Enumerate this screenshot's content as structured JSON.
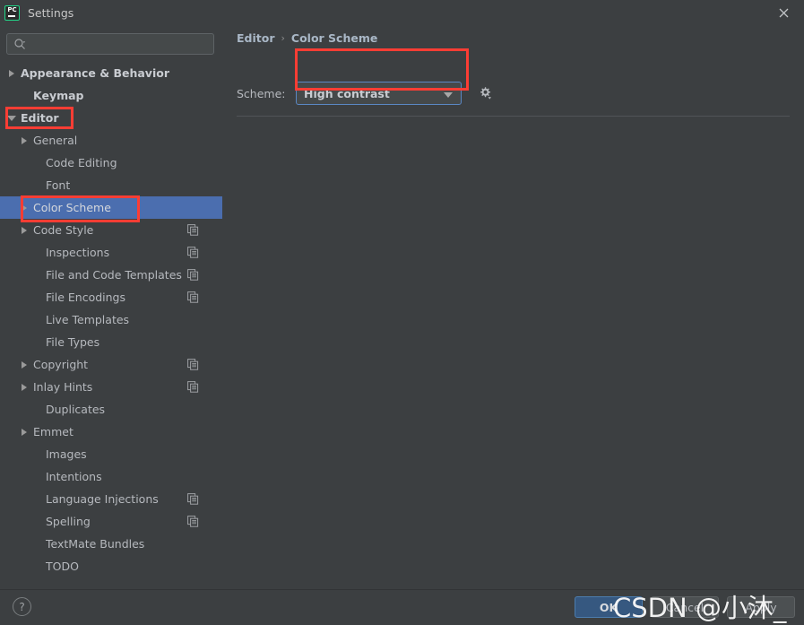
{
  "window": {
    "title": "Settings",
    "logo_icon": "pycharm-logo-icon",
    "close_icon": "close-icon"
  },
  "search": {
    "placeholder": "",
    "value": "",
    "icon": "search-icon"
  },
  "sidebar": {
    "items": [
      {
        "label": "Appearance & Behavior",
        "indent": 0,
        "twisty": "collapsed",
        "bold": true,
        "selected": false,
        "copy": false
      },
      {
        "label": "Keymap",
        "indent": 1,
        "twisty": "none",
        "bold": true,
        "selected": false,
        "copy": false
      },
      {
        "label": "Editor",
        "indent": 0,
        "twisty": "expanded",
        "bold": true,
        "selected": false,
        "copy": false
      },
      {
        "label": "General",
        "indent": 1,
        "twisty": "collapsed",
        "bold": false,
        "selected": false,
        "copy": false
      },
      {
        "label": "Code Editing",
        "indent": 2,
        "twisty": "none",
        "bold": false,
        "selected": false,
        "copy": false
      },
      {
        "label": "Font",
        "indent": 2,
        "twisty": "none",
        "bold": false,
        "selected": false,
        "copy": false
      },
      {
        "label": "Color Scheme",
        "indent": 1,
        "twisty": "collapsed",
        "bold": false,
        "selected": true,
        "copy": false
      },
      {
        "label": "Code Style",
        "indent": 1,
        "twisty": "collapsed",
        "bold": false,
        "selected": false,
        "copy": true
      },
      {
        "label": "Inspections",
        "indent": 2,
        "twisty": "none",
        "bold": false,
        "selected": false,
        "copy": true
      },
      {
        "label": "File and Code Templates",
        "indent": 2,
        "twisty": "none",
        "bold": false,
        "selected": false,
        "copy": true
      },
      {
        "label": "File Encodings",
        "indent": 2,
        "twisty": "none",
        "bold": false,
        "selected": false,
        "copy": true
      },
      {
        "label": "Live Templates",
        "indent": 2,
        "twisty": "none",
        "bold": false,
        "selected": false,
        "copy": false
      },
      {
        "label": "File Types",
        "indent": 2,
        "twisty": "none",
        "bold": false,
        "selected": false,
        "copy": false
      },
      {
        "label": "Copyright",
        "indent": 1,
        "twisty": "collapsed",
        "bold": false,
        "selected": false,
        "copy": true
      },
      {
        "label": "Inlay Hints",
        "indent": 1,
        "twisty": "collapsed",
        "bold": false,
        "selected": false,
        "copy": true
      },
      {
        "label": "Duplicates",
        "indent": 2,
        "twisty": "none",
        "bold": false,
        "selected": false,
        "copy": false
      },
      {
        "label": "Emmet",
        "indent": 1,
        "twisty": "collapsed",
        "bold": false,
        "selected": false,
        "copy": false
      },
      {
        "label": "Images",
        "indent": 2,
        "twisty": "none",
        "bold": false,
        "selected": false,
        "copy": false
      },
      {
        "label": "Intentions",
        "indent": 2,
        "twisty": "none",
        "bold": false,
        "selected": false,
        "copy": false
      },
      {
        "label": "Language Injections",
        "indent": 2,
        "twisty": "none",
        "bold": false,
        "selected": false,
        "copy": true
      },
      {
        "label": "Spelling",
        "indent": 2,
        "twisty": "none",
        "bold": false,
        "selected": false,
        "copy": true
      },
      {
        "label": "TextMate Bundles",
        "indent": 2,
        "twisty": "none",
        "bold": false,
        "selected": false,
        "copy": false
      },
      {
        "label": "TODO",
        "indent": 2,
        "twisty": "none",
        "bold": false,
        "selected": false,
        "copy": false
      }
    ]
  },
  "content": {
    "breadcrumb": {
      "parent": "Editor",
      "separator": "›",
      "current": "Color Scheme"
    },
    "scheme": {
      "label": "Scheme:",
      "value": "High contrast",
      "dropdown_icon": "chevron-down-icon",
      "gear_icon": "gear-icon"
    }
  },
  "footer": {
    "help_label": "?",
    "ok_label": "OK",
    "cancel_label": "Cancel",
    "apply_label": "Apply"
  },
  "watermark": {
    "text": "CSDN @小沐_"
  },
  "colors": {
    "window_bg": "#3c3f41",
    "selection_blue": "#4b6eaf",
    "ok_button_blue": "#365880",
    "focus_border_blue": "#5a87c4",
    "annotation_red": "#fc3d34",
    "logo_green": "#21d789"
  }
}
